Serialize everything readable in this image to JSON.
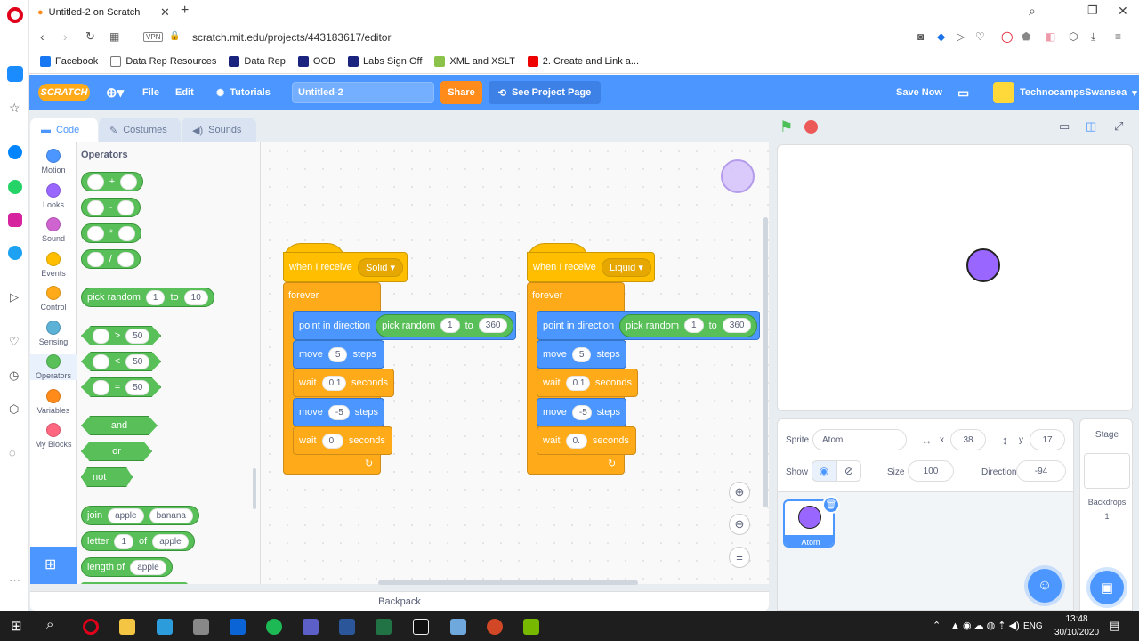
{
  "browser": {
    "tab_title": "Untitled-2 on Scratch",
    "url": "scratch.mit.edu/projects/443183617/editor",
    "vpn": "VPN",
    "bookmarks": [
      "Facebook",
      "Data Rep Resources",
      "Data Rep",
      "OOD",
      "Labs Sign Off",
      "XML and XSLT",
      "2. Create and Link a..."
    ]
  },
  "menu": {
    "logo": "SCRATCH",
    "file": "File",
    "edit": "Edit",
    "tutorials": "Tutorials",
    "project_title": "Untitled-2",
    "share": "Share",
    "see_project": "See Project Page",
    "save_now": "Save Now",
    "username": "TechnocampsSwansea"
  },
  "editor_tabs": {
    "code": "Code",
    "costumes": "Costumes",
    "sounds": "Sounds"
  },
  "categories": [
    {
      "label": "Motion",
      "color": "#4c97ff"
    },
    {
      "label": "Looks",
      "color": "#9966ff"
    },
    {
      "label": "Sound",
      "color": "#cf63cf"
    },
    {
      "label": "Events",
      "color": "#ffbf00"
    },
    {
      "label": "Control",
      "color": "#ffab19"
    },
    {
      "label": "Sensing",
      "color": "#5cb1d6"
    },
    {
      "label": "Operators",
      "color": "#59c059"
    },
    {
      "label": "Variables",
      "color": "#ff8c1a"
    },
    {
      "label": "My Blocks",
      "color": "#ff6680"
    }
  ],
  "palette": {
    "heading": "Operators",
    "add": "+",
    "sub": "-",
    "mul": "*",
    "div": "/",
    "pick_random": "pick random",
    "to": "to",
    "pr_a": "1",
    "pr_b": "10",
    "gt": ">",
    "lt": "<",
    "eq": "=",
    "fifty": "50",
    "and": "and",
    "or": "or",
    "not": "not",
    "join": "join",
    "apple": "apple",
    "banana": "banana",
    "letter": "letter",
    "of": "of",
    "one": "1",
    "length_of": "length of"
  },
  "scripts": [
    {
      "hat_label": "when I receive",
      "message": "Solid",
      "forever": "forever",
      "point": "point in direction",
      "pick": "pick random",
      "to": "to",
      "from": "1",
      "upto": "360",
      "move": "move",
      "steps": "steps",
      "m1": "5",
      "m2": "-5",
      "wait": "wait",
      "seconds": "seconds",
      "w1": "0.1",
      "w2": "0."
    },
    {
      "hat_label": "when I receive",
      "message": "Liquid",
      "forever": "forever",
      "point": "point in direction",
      "pick": "pick random",
      "to": "to",
      "from": "1",
      "upto": "360",
      "move": "move",
      "steps": "steps",
      "m1": "5",
      "m2": "-5",
      "wait": "wait",
      "seconds": "seconds",
      "w1": "0.1",
      "w2": "0."
    }
  ],
  "backpack": "Backpack",
  "sprite_info": {
    "sprite_label": "Sprite",
    "sprite_name": "Atom",
    "x_label": "x",
    "x": "38",
    "y_label": "y",
    "y": "17",
    "show_label": "Show",
    "size_label": "Size",
    "size": "100",
    "direction_label": "Direction",
    "direction": "-94"
  },
  "sprite_list": [
    {
      "name": "Atom",
      "color": "#9966ff"
    }
  ],
  "stage_pane": {
    "title": "Stage",
    "backdrops_label": "Backdrops",
    "backdrops_count": "1"
  },
  "taskbar": {
    "lang": "ENG",
    "time": "13:48",
    "date": "30/10/2020"
  }
}
